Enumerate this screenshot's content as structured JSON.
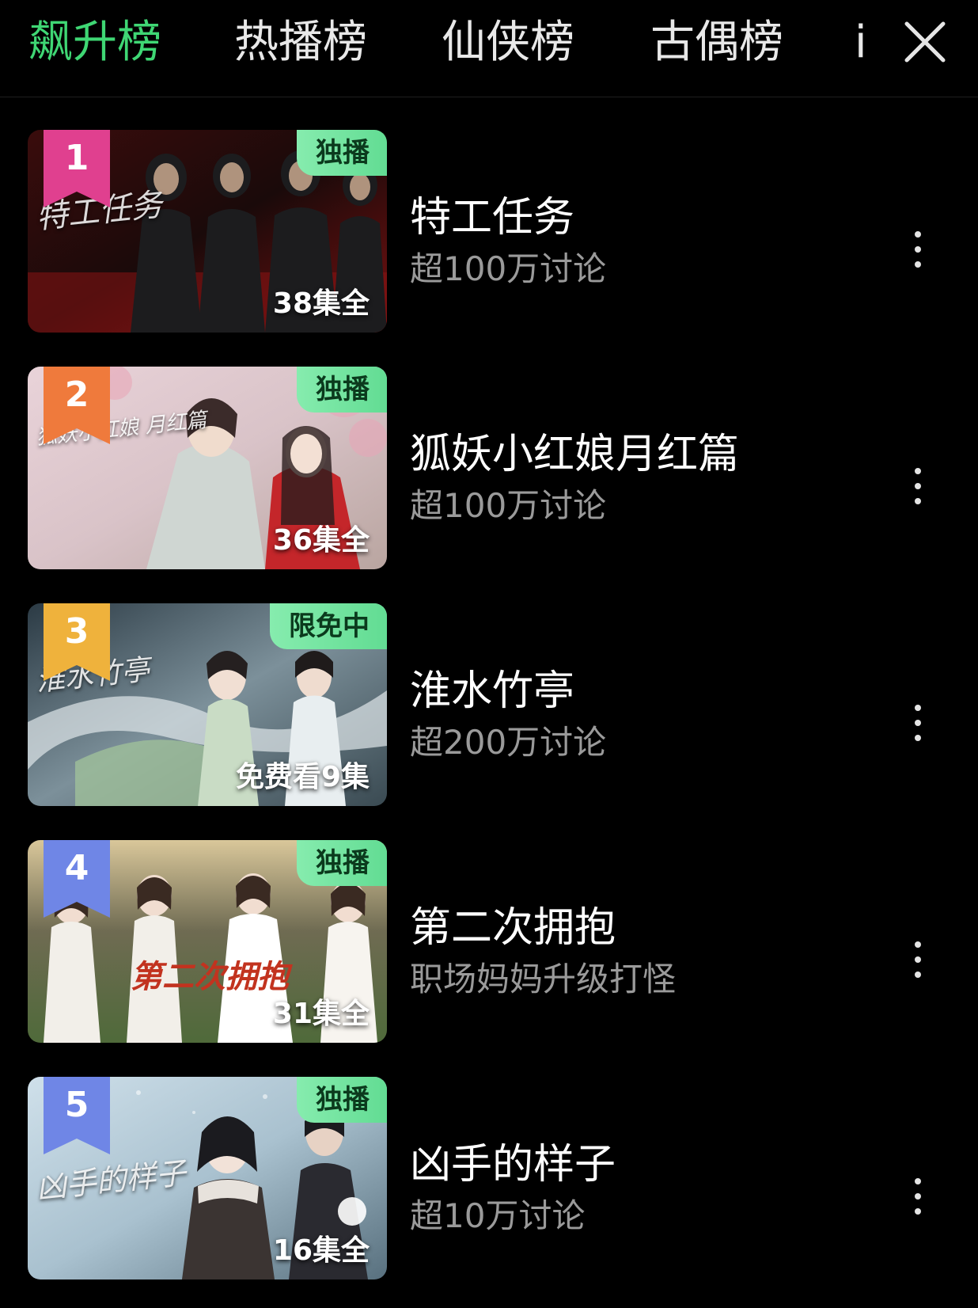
{
  "tabs": [
    {
      "label": "飙升榜",
      "active": true
    },
    {
      "label": "热播榜",
      "active": false
    },
    {
      "label": "仙侠榜",
      "active": false
    },
    {
      "label": "古偶榜",
      "active": false
    },
    {
      "label": "i",
      "active": false
    }
  ],
  "close_icon": "close-x-icon",
  "colors": {
    "accent": "#3fd774",
    "badge": "#7ae6a2",
    "rank_1": "#e0408f",
    "rank_2": "#ef7a3c",
    "rank_3": "#efb23c",
    "rank_4": "#6f86e6",
    "rank_5": "#6f86e6"
  },
  "items": [
    {
      "rank": "1",
      "badge": "独播",
      "episodes": "38集全",
      "poster_text": "特工任务",
      "title": "特工任务",
      "subtitle": "超100万讨论"
    },
    {
      "rank": "2",
      "badge": "独播",
      "episodes": "36集全",
      "poster_text": "狐妖小红娘 月红篇",
      "title": "狐妖小红娘月红篇",
      "subtitle": "超100万讨论"
    },
    {
      "rank": "3",
      "badge": "限免中",
      "episodes": "免费看9集",
      "poster_text": "淮水竹亭",
      "title": "淮水竹亭",
      "subtitle": "超200万讨论"
    },
    {
      "rank": "4",
      "badge": "独播",
      "episodes": "31集全",
      "poster_text": "第二次拥抱",
      "title": "第二次拥抱",
      "subtitle": "职场妈妈升级打怪"
    },
    {
      "rank": "5",
      "badge": "独播",
      "episodes": "16集全",
      "poster_text": "凶手的样子",
      "title": "凶手的样子",
      "subtitle": "超10万讨论"
    }
  ]
}
